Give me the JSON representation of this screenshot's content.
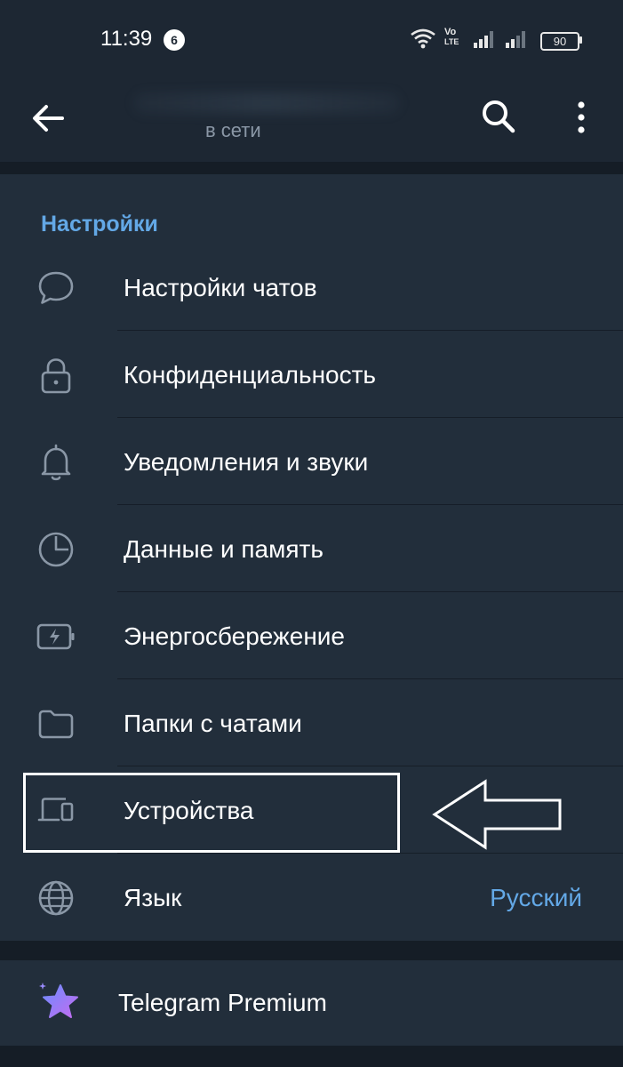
{
  "status_bar": {
    "time": "11:39",
    "notification_count": "6",
    "network_label_top": "Vo",
    "network_label_bottom": "LTE",
    "battery": "90"
  },
  "header": {
    "subtitle": "в сети",
    "back_icon": "arrow-left-icon",
    "search_icon": "search-icon",
    "more_icon": "more-vertical-icon"
  },
  "settings": {
    "section_title": "Настройки",
    "items": [
      {
        "label": "Настройки чатов",
        "icon": "chat-bubble-icon"
      },
      {
        "label": "Конфиденциальность",
        "icon": "lock-icon"
      },
      {
        "label": "Уведомления и звуки",
        "icon": "bell-icon"
      },
      {
        "label": "Данные и память",
        "icon": "pie-chart-icon"
      },
      {
        "label": "Энергосбережение",
        "icon": "battery-bolt-icon"
      },
      {
        "label": "Папки с чатами",
        "icon": "folder-icon"
      },
      {
        "label": "Устройства",
        "icon": "devices-icon"
      },
      {
        "label": "Язык",
        "icon": "globe-icon",
        "value": "Русский"
      }
    ]
  },
  "premium": {
    "label": "Telegram Premium",
    "icon": "premium-star-icon"
  },
  "colors": {
    "background": "#1d2733",
    "card": "#222e3b",
    "accent": "#63a8e6",
    "premium_gradient": [
      "#6c8cff",
      "#c46cf0"
    ]
  }
}
